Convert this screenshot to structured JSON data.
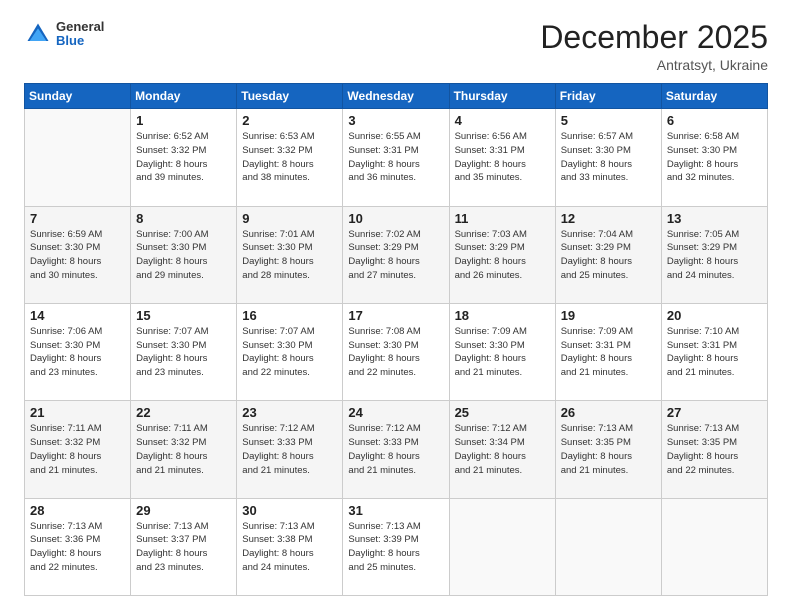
{
  "header": {
    "logo_general": "General",
    "logo_blue": "Blue",
    "month_title": "December 2025",
    "location": "Antratsyt, Ukraine"
  },
  "days_of_week": [
    "Sunday",
    "Monday",
    "Tuesday",
    "Wednesday",
    "Thursday",
    "Friday",
    "Saturday"
  ],
  "weeks": [
    [
      {
        "day": "",
        "info": ""
      },
      {
        "day": "1",
        "info": "Sunrise: 6:52 AM\nSunset: 3:32 PM\nDaylight: 8 hours\nand 39 minutes."
      },
      {
        "day": "2",
        "info": "Sunrise: 6:53 AM\nSunset: 3:32 PM\nDaylight: 8 hours\nand 38 minutes."
      },
      {
        "day": "3",
        "info": "Sunrise: 6:55 AM\nSunset: 3:31 PM\nDaylight: 8 hours\nand 36 minutes."
      },
      {
        "day": "4",
        "info": "Sunrise: 6:56 AM\nSunset: 3:31 PM\nDaylight: 8 hours\nand 35 minutes."
      },
      {
        "day": "5",
        "info": "Sunrise: 6:57 AM\nSunset: 3:30 PM\nDaylight: 8 hours\nand 33 minutes."
      },
      {
        "day": "6",
        "info": "Sunrise: 6:58 AM\nSunset: 3:30 PM\nDaylight: 8 hours\nand 32 minutes."
      }
    ],
    [
      {
        "day": "7",
        "info": "Sunrise: 6:59 AM\nSunset: 3:30 PM\nDaylight: 8 hours\nand 30 minutes."
      },
      {
        "day": "8",
        "info": "Sunrise: 7:00 AM\nSunset: 3:30 PM\nDaylight: 8 hours\nand 29 minutes."
      },
      {
        "day": "9",
        "info": "Sunrise: 7:01 AM\nSunset: 3:30 PM\nDaylight: 8 hours\nand 28 minutes."
      },
      {
        "day": "10",
        "info": "Sunrise: 7:02 AM\nSunset: 3:29 PM\nDaylight: 8 hours\nand 27 minutes."
      },
      {
        "day": "11",
        "info": "Sunrise: 7:03 AM\nSunset: 3:29 PM\nDaylight: 8 hours\nand 26 minutes."
      },
      {
        "day": "12",
        "info": "Sunrise: 7:04 AM\nSunset: 3:29 PM\nDaylight: 8 hours\nand 25 minutes."
      },
      {
        "day": "13",
        "info": "Sunrise: 7:05 AM\nSunset: 3:29 PM\nDaylight: 8 hours\nand 24 minutes."
      }
    ],
    [
      {
        "day": "14",
        "info": "Sunrise: 7:06 AM\nSunset: 3:30 PM\nDaylight: 8 hours\nand 23 minutes."
      },
      {
        "day": "15",
        "info": "Sunrise: 7:07 AM\nSunset: 3:30 PM\nDaylight: 8 hours\nand 23 minutes."
      },
      {
        "day": "16",
        "info": "Sunrise: 7:07 AM\nSunset: 3:30 PM\nDaylight: 8 hours\nand 22 minutes."
      },
      {
        "day": "17",
        "info": "Sunrise: 7:08 AM\nSunset: 3:30 PM\nDaylight: 8 hours\nand 22 minutes."
      },
      {
        "day": "18",
        "info": "Sunrise: 7:09 AM\nSunset: 3:30 PM\nDaylight: 8 hours\nand 21 minutes."
      },
      {
        "day": "19",
        "info": "Sunrise: 7:09 AM\nSunset: 3:31 PM\nDaylight: 8 hours\nand 21 minutes."
      },
      {
        "day": "20",
        "info": "Sunrise: 7:10 AM\nSunset: 3:31 PM\nDaylight: 8 hours\nand 21 minutes."
      }
    ],
    [
      {
        "day": "21",
        "info": "Sunrise: 7:11 AM\nSunset: 3:32 PM\nDaylight: 8 hours\nand 21 minutes."
      },
      {
        "day": "22",
        "info": "Sunrise: 7:11 AM\nSunset: 3:32 PM\nDaylight: 8 hours\nand 21 minutes."
      },
      {
        "day": "23",
        "info": "Sunrise: 7:12 AM\nSunset: 3:33 PM\nDaylight: 8 hours\nand 21 minutes."
      },
      {
        "day": "24",
        "info": "Sunrise: 7:12 AM\nSunset: 3:33 PM\nDaylight: 8 hours\nand 21 minutes."
      },
      {
        "day": "25",
        "info": "Sunrise: 7:12 AM\nSunset: 3:34 PM\nDaylight: 8 hours\nand 21 minutes."
      },
      {
        "day": "26",
        "info": "Sunrise: 7:13 AM\nSunset: 3:35 PM\nDaylight: 8 hours\nand 21 minutes."
      },
      {
        "day": "27",
        "info": "Sunrise: 7:13 AM\nSunset: 3:35 PM\nDaylight: 8 hours\nand 22 minutes."
      }
    ],
    [
      {
        "day": "28",
        "info": "Sunrise: 7:13 AM\nSunset: 3:36 PM\nDaylight: 8 hours\nand 22 minutes."
      },
      {
        "day": "29",
        "info": "Sunrise: 7:13 AM\nSunset: 3:37 PM\nDaylight: 8 hours\nand 23 minutes."
      },
      {
        "day": "30",
        "info": "Sunrise: 7:13 AM\nSunset: 3:38 PM\nDaylight: 8 hours\nand 24 minutes."
      },
      {
        "day": "31",
        "info": "Sunrise: 7:13 AM\nSunset: 3:39 PM\nDaylight: 8 hours\nand 25 minutes."
      },
      {
        "day": "",
        "info": ""
      },
      {
        "day": "",
        "info": ""
      },
      {
        "day": "",
        "info": ""
      }
    ]
  ]
}
